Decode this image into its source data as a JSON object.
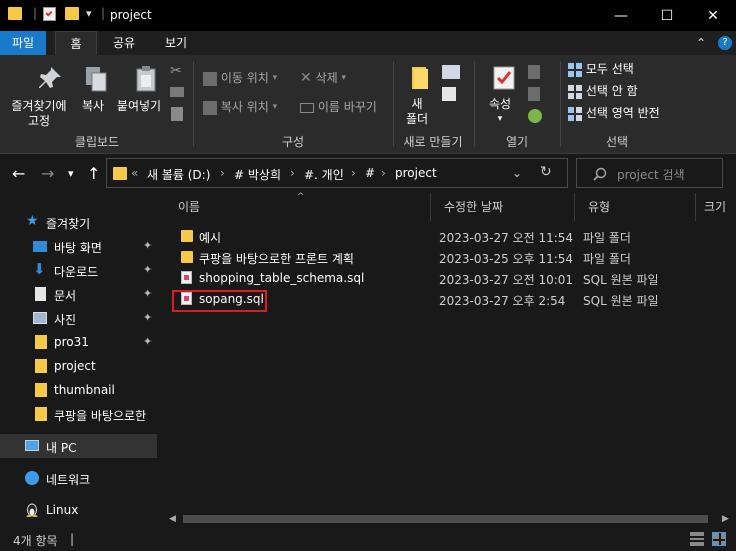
{
  "window": {
    "title": "project",
    "minimize_glyph": "—",
    "maximize_glyph": "☐",
    "close_glyph": "✕",
    "quick_access_down": "▾",
    "title_sep": "|"
  },
  "ribbon_tabs": {
    "file": "파일",
    "home": "홈",
    "share": "공유",
    "view": "보기",
    "collapse_glyph": "⌃",
    "help_glyph": "?"
  },
  "ribbon": {
    "clipboard": {
      "pin_label_1": "즐겨찾기에",
      "pin_label_2": "고정",
      "copy": "복사",
      "paste": "붙여넣기",
      "group": "클립보드"
    },
    "organize": {
      "move_to": "이동 위치",
      "copy_to": "복사 위치",
      "delete": "삭제",
      "rename": "이름 바꾸기",
      "group": "구성",
      "dropdown": "▾"
    },
    "new": {
      "new_folder_1": "새",
      "new_folder_2": "폴더",
      "group": "새로 만들기"
    },
    "open": {
      "properties": "속성",
      "group": "열기",
      "dropdown": "▾"
    },
    "select": {
      "select_all": "모두 선택",
      "select_none": "선택 안 함",
      "invert": "선택 영역 반전",
      "group": "선택"
    }
  },
  "address": {
    "back": "←",
    "forward": "→",
    "recent": "▾",
    "up": "↑",
    "overflow": "«",
    "crumbs": [
      "새 볼륨 (D:)",
      "# 박상희",
      "#. 개인",
      "#",
      "project"
    ],
    "crumb_sep": "›",
    "dropdown": "⌄",
    "refresh": "↻",
    "search_placeholder": "project 검색"
  },
  "nav_pane": {
    "quick_access": "즐겨찾기",
    "items": [
      {
        "label": "바탕 화면",
        "pinned": true
      },
      {
        "label": "다운로드",
        "pinned": true
      },
      {
        "label": "문서",
        "pinned": true
      },
      {
        "label": "사진",
        "pinned": true
      },
      {
        "label": "pro31",
        "pinned": true
      },
      {
        "label": "project",
        "pinned": false
      },
      {
        "label": "thumbnail",
        "pinned": false
      },
      {
        "label": "쿠팡을 바탕으로한",
        "pinned": false
      }
    ],
    "pin_glyph": "📌",
    "this_pc": "내 PC",
    "network": "네트워크",
    "linux": "Linux"
  },
  "file_list": {
    "columns": {
      "name": "이름",
      "modified": "수정한 날짜",
      "type": "유형",
      "size": "크기"
    },
    "sort_glyph": "^",
    "rows": [
      {
        "name": "예시",
        "modified": "2023-03-27 오전 11:54",
        "type": "파일 폴더",
        "kind": "folder"
      },
      {
        "name": "쿠팡을 바탕으로한 프론트 계획",
        "modified": "2023-03-25 오후 11:54",
        "type": "파일 폴더",
        "kind": "folder"
      },
      {
        "name": "shopping_table_schema.sql",
        "modified": "2023-03-27 오전 10:01",
        "type": "SQL 원본 파일",
        "kind": "sql"
      },
      {
        "name": "sopang.sql",
        "modified": "2023-03-27 오후 2:54",
        "type": "SQL 원본 파일",
        "kind": "sql"
      }
    ]
  },
  "status": {
    "item_count": "4개 항목",
    "sep": "|"
  },
  "colors": {
    "accent": "#1979ca",
    "folder": "#f7c948",
    "highlight": "#e11b1b",
    "background": "#191919"
  }
}
